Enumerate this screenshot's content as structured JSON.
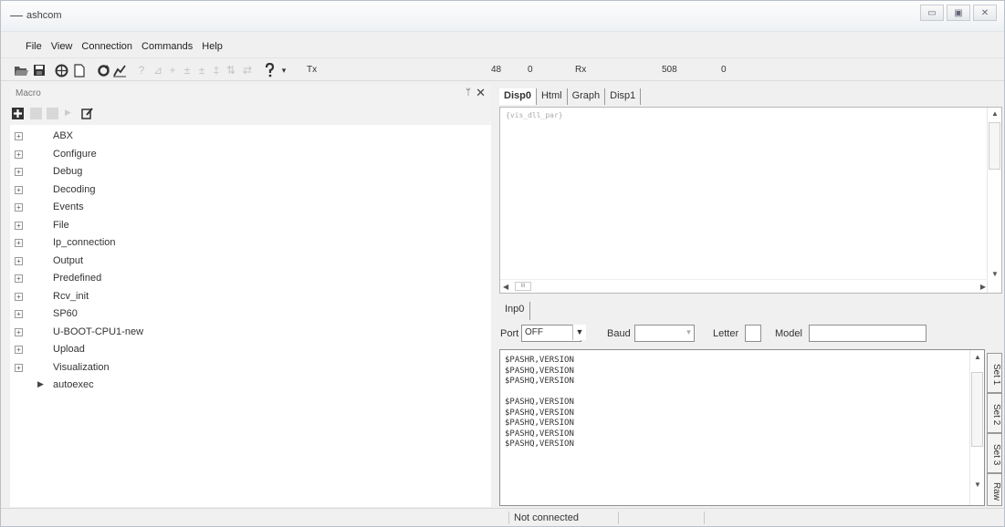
{
  "window": {
    "title": "ashcom",
    "controls": [
      "▭",
      "▣",
      "✕"
    ]
  },
  "menu": [
    "File",
    "View",
    "Connection",
    "Commands",
    "Help"
  ],
  "toolbar": {
    "tx_label": "Tx",
    "tx_value1": "48",
    "tx_value2": "0",
    "rx_label": "Rx",
    "rx_value1": "508",
    "rx_value2": "0"
  },
  "macro": {
    "title": "Macro",
    "pin": "ᛘ",
    "close": "✕",
    "items": [
      {
        "label": "ABX",
        "expander": "+"
      },
      {
        "label": "Configure",
        "expander": "+"
      },
      {
        "label": "Debug",
        "expander": "+"
      },
      {
        "label": "Decoding",
        "expander": "+"
      },
      {
        "label": "Events",
        "expander": "+"
      },
      {
        "label": "File",
        "expander": "+"
      },
      {
        "label": "Ip_connection",
        "expander": "+"
      },
      {
        "label": "Output",
        "expander": "+"
      },
      {
        "label": "Predefined",
        "expander": "+"
      },
      {
        "label": "Rcv_init",
        "expander": "+"
      },
      {
        "label": "SP60",
        "expander": "+"
      },
      {
        "label": "U-BOOT-CPU1-new",
        "expander": "+"
      },
      {
        "label": "Upload",
        "expander": "+"
      },
      {
        "label": "Visualization",
        "expander": "+"
      }
    ],
    "autoexec": {
      "label": "autoexec",
      "arrow": "▶"
    }
  },
  "display": {
    "tabs": [
      "Disp0",
      "Html",
      "Graph",
      "Disp1"
    ],
    "content": "{vis_dll_par}"
  },
  "input": {
    "tab": "Inp0",
    "port_label": "Port",
    "port_value": "OFF",
    "baud_label": "Baud",
    "baud_value": "",
    "letter_label": "Letter",
    "letter_value": "",
    "model_label": "Model",
    "model_value": "",
    "lines": [
      "$PASHR,VERSION",
      "$PASHQ,VERSION",
      "$PASHQ,VERSION",
      "",
      "$PASHQ,VERSION",
      "$PASHQ,VERSION",
      "$PASHQ,VERSION",
      "$PASHQ,VERSION",
      "$PASHQ,VERSION"
    ],
    "side_tabs": [
      "Set 1",
      "Set 2",
      "Set 3",
      "Raw"
    ]
  },
  "status": {
    "text": "Not connected"
  }
}
